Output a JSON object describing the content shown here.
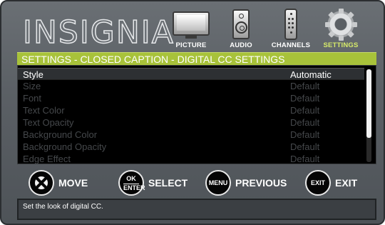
{
  "brand": "INSIGNIA",
  "nav": {
    "tabs": [
      {
        "label": "PICTURE",
        "icon": "picture-icon",
        "active": false
      },
      {
        "label": "AUDIO",
        "icon": "audio-icon",
        "active": false
      },
      {
        "label": "CHANNELS",
        "icon": "channels-icon",
        "active": false
      },
      {
        "label": "SETTINGS",
        "icon": "settings-icon",
        "active": true
      }
    ]
  },
  "title": "SETTINGS - CLOSED CAPTION - DIGITAL CC SETTINGS",
  "list": {
    "items": [
      {
        "name": "Style",
        "value": "Automatic",
        "selected": true,
        "enabled": true
      },
      {
        "name": "Size",
        "value": "Default",
        "selected": false,
        "enabled": false
      },
      {
        "name": "Font",
        "value": "Default",
        "selected": false,
        "enabled": false
      },
      {
        "name": "Text Color",
        "value": "Default",
        "selected": false,
        "enabled": false
      },
      {
        "name": "Text Opacity",
        "value": "Default",
        "selected": false,
        "enabled": false
      },
      {
        "name": "Background Color",
        "value": "Default",
        "selected": false,
        "enabled": false
      },
      {
        "name": "Background Opacity",
        "value": "Default",
        "selected": false,
        "enabled": false
      },
      {
        "name": "Edge Effect",
        "value": "Default",
        "selected": false,
        "enabled": false
      }
    ]
  },
  "footer": {
    "move": {
      "label": "MOVE"
    },
    "select": {
      "key_top": "OK",
      "key_bottom": "ENTER",
      "label": "SELECT"
    },
    "previous": {
      "key": "MENU",
      "label": "PREVIOUS"
    },
    "exit": {
      "key": "EXIT",
      "label": "EXIT"
    }
  },
  "help_text": "Set the look of digital CC.",
  "colors": {
    "accent": "#a8c23a",
    "active_tab": "#d6ea6a",
    "disabled_text": "#45484b"
  }
}
